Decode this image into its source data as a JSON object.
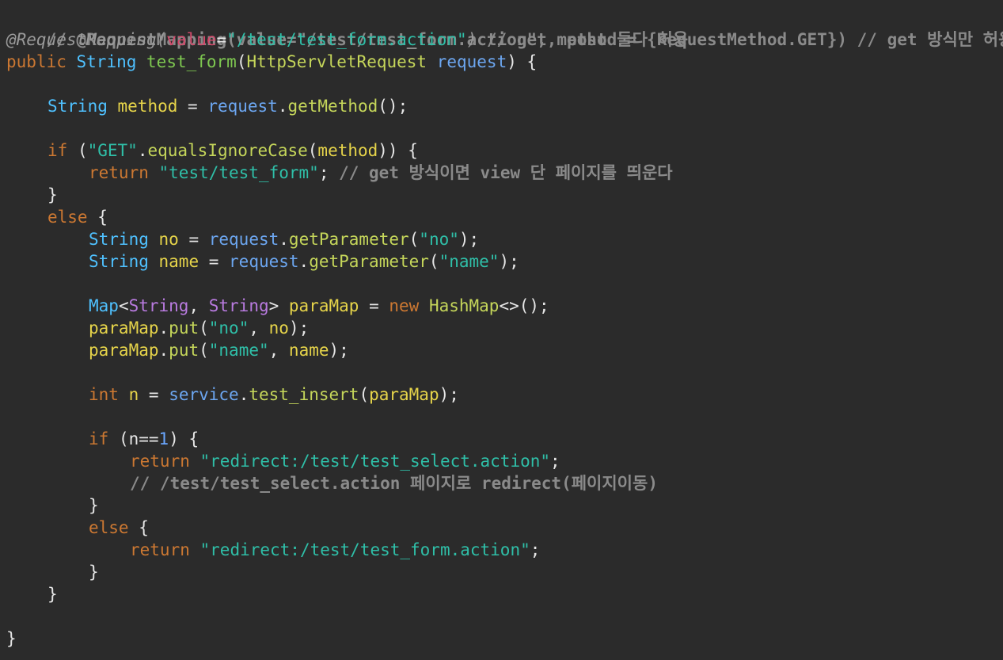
{
  "code": {
    "l01_comment": "// @RequestMapping(value=\"/test/test_form.action\", method = {RequestMethod.GET}) // get 방식만 허용",
    "l02_ann": "@RequestMapping(",
    "l02_attr": "value",
    "l02_eq": "=",
    "l02_str": "\"/test/test_form.action\"",
    "l02_close": ")",
    "l02_comment": " // get, post 둘다 허용",
    "l03_public": "public",
    "l03_type": "String",
    "l03_fn": "test_form",
    "l03_open": "(",
    "l03_ptype": "HttpServletRequest",
    "l03_pname": "request",
    "l03_close": ") {",
    "l05_type": "String",
    "l05_var": "method",
    "l05_eq": " = ",
    "l05_obj": "request",
    "l05_dot": ".",
    "l05_call": "getMethod",
    "l05_end": "();",
    "l07_if": "if",
    "l07_open": " (",
    "l07_str": "\"GET\"",
    "l07_dot": ".",
    "l07_call": "equalsIgnoreCase",
    "l07_paren": "(",
    "l07_var": "method",
    "l07_end": ")) {",
    "l08_return": "return",
    "l08_str": "\"test/test_form\"",
    "l08_semi": ";",
    "l08_comment": " // get 방식이면 view 단 페이지를 띄운다",
    "l09_brace": "}",
    "l10_else": "else",
    "l10_brace": " {",
    "l11_type": "String",
    "l11_var": "no",
    "l11_eq": " = ",
    "l11_obj": "request",
    "l11_dot": ".",
    "l11_call": "getParameter",
    "l11_open": "(",
    "l11_str": "\"no\"",
    "l11_end": ");",
    "l12_type": "String",
    "l12_var": "name",
    "l12_eq": " = ",
    "l12_obj": "request",
    "l12_dot": ".",
    "l12_call": "getParameter",
    "l12_open": "(",
    "l12_str": "\"name\"",
    "l12_end": ");",
    "l14_map": "Map",
    "l14_lt": "<",
    "l14_t1": "String",
    "l14_comma": ", ",
    "l14_t2": "String",
    "l14_gt": "> ",
    "l14_var": "paraMap",
    "l14_eq": " = ",
    "l14_new": "new",
    "l14_cls": "HashMap",
    "l14_end": "<>();",
    "l15_obj": "paraMap",
    "l15_dot": ".",
    "l15_call": "put",
    "l15_open": "(",
    "l15_str": "\"no\"",
    "l15_comma": ", ",
    "l15_var": "no",
    "l15_end": ");",
    "l16_obj": "paraMap",
    "l16_dot": ".",
    "l16_call": "put",
    "l16_open": "(",
    "l16_str": "\"name\"",
    "l16_comma": ", ",
    "l16_var": "name",
    "l16_end": ");",
    "l18_int": "int",
    "l18_var": "n",
    "l18_eq": " = ",
    "l18_obj": "service",
    "l18_dot": ".",
    "l18_call": "test_insert",
    "l18_open": "(",
    "l18_arg": "paraMap",
    "l18_end": ");",
    "l20_if": "if",
    "l20_open": " (",
    "l20_var": "n",
    "l20_op": "==",
    "l20_num": "1",
    "l20_end": ") {",
    "l21_return": "return",
    "l21_str": "\"redirect:/test/test_select.action\"",
    "l21_semi": ";",
    "l22_comment": "// /test/test_select.action 페이지로 redirect(페이지이동)",
    "l23_brace": "}",
    "l24_else": "else",
    "l24_brace": " {",
    "l25_return": "return",
    "l25_str": "\"redirect:/test/test_form.action\"",
    "l25_semi": ";",
    "l26_brace": "}",
    "l27_brace": "}",
    "l29_brace": "}"
  }
}
